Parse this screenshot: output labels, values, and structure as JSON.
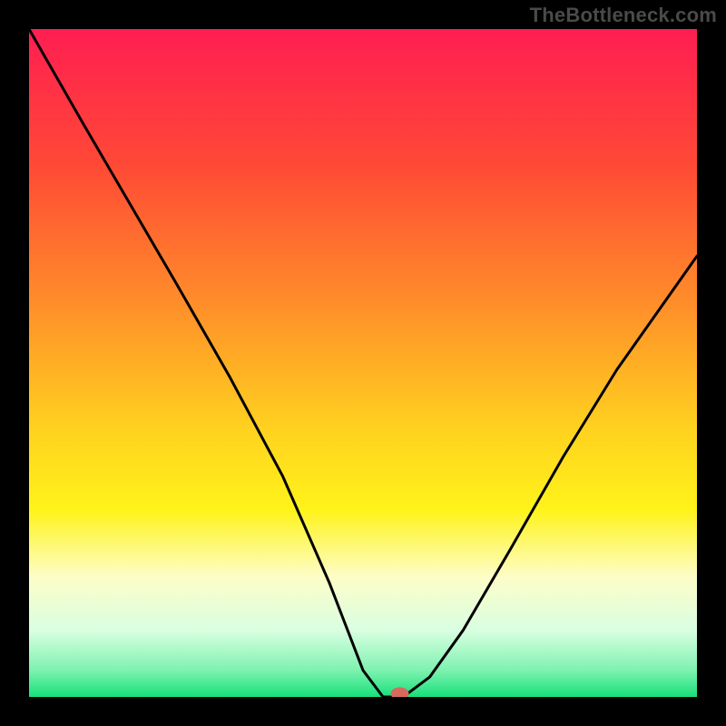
{
  "watermark": "TheBottleneck.com",
  "chart_data": {
    "type": "line",
    "title": "",
    "xlabel": "",
    "ylabel": "",
    "xlim": [
      0,
      1
    ],
    "ylim": [
      0,
      1
    ],
    "series": [
      {
        "name": "curve",
        "x": [
          0.0,
          0.08,
          0.15,
          0.22,
          0.3,
          0.38,
          0.45,
          0.5,
          0.53,
          0.56,
          0.6,
          0.65,
          0.72,
          0.8,
          0.88,
          1.0
        ],
        "y": [
          1.0,
          0.86,
          0.74,
          0.62,
          0.48,
          0.33,
          0.17,
          0.04,
          0.0,
          0.0,
          0.03,
          0.1,
          0.22,
          0.36,
          0.49,
          0.66
        ]
      }
    ],
    "marker": {
      "x": 0.555,
      "y": 0.005
    },
    "background_gradient": {
      "stops": [
        {
          "offset": 0.0,
          "color": "#ff1e52"
        },
        {
          "offset": 0.2,
          "color": "#ff4836"
        },
        {
          "offset": 0.4,
          "color": "#ff8a2a"
        },
        {
          "offset": 0.6,
          "color": "#ffd21f"
        },
        {
          "offset": 0.72,
          "color": "#fff31a"
        },
        {
          "offset": 0.82,
          "color": "#fdfdc8"
        },
        {
          "offset": 0.9,
          "color": "#d9ffe1"
        },
        {
          "offset": 0.96,
          "color": "#7ef2b0"
        },
        {
          "offset": 1.0,
          "color": "#17e07a"
        }
      ]
    },
    "grid": false,
    "legend": false
  }
}
